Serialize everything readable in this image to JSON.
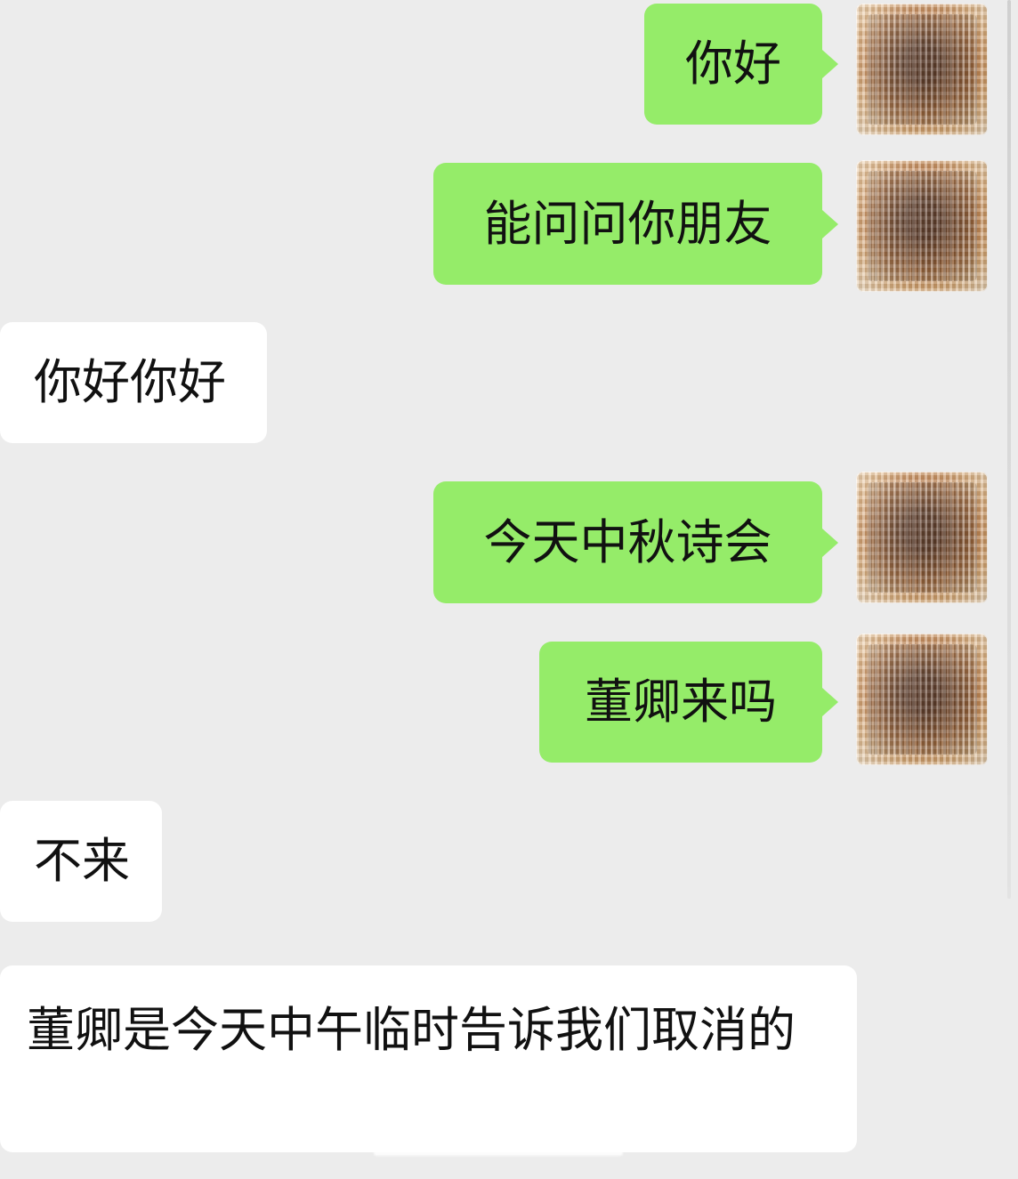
{
  "messages": [
    {
      "type": "sent",
      "text": "你好",
      "avatar_icon": "user-avatar-icon"
    },
    {
      "type": "sent",
      "text": "能问问你朋友",
      "avatar_icon": "user-avatar-icon"
    },
    {
      "type": "received",
      "text": "你好你好"
    },
    {
      "type": "sent",
      "text": "今天中秋诗会",
      "avatar_icon": "user-avatar-icon"
    },
    {
      "type": "sent",
      "text": "董卿来吗",
      "avatar_icon": "user-avatar-icon"
    },
    {
      "type": "received",
      "text": "不来"
    },
    {
      "type": "received",
      "text": "董卿是今天中午临时告诉我们取消的"
    }
  ],
  "colors": {
    "background": "#ececec",
    "sent_bubble": "#95ec69",
    "received_bubble": "#ffffff"
  }
}
